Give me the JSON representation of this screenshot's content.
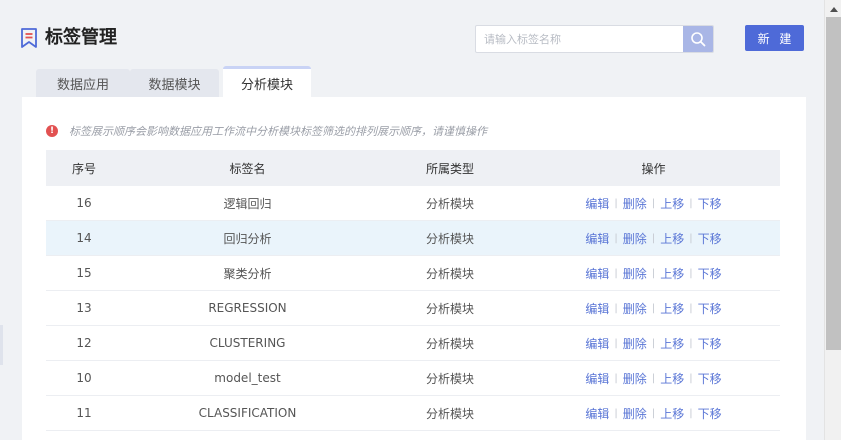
{
  "header": {
    "title": "标签管理",
    "search_placeholder": "请输入标签名称",
    "search_value": "",
    "new_button": "新 建",
    "icon": "bookmark-list-icon"
  },
  "tabs": [
    {
      "label": "数据应用",
      "active": false
    },
    {
      "label": "数据模块",
      "active": false
    },
    {
      "label": "分析模块",
      "active": true
    }
  ],
  "notice": {
    "icon": "alert-circle-icon",
    "text": "标签展示顺序会影响数据应用工作流中分析模块标签筛选的排列展示顺序，请谨慎操作"
  },
  "table": {
    "headers": [
      "序号",
      "标签名",
      "所属类型",
      "操作"
    ],
    "actions": [
      "编辑",
      "删除",
      "上移",
      "下移"
    ],
    "rows": [
      {
        "index": "16",
        "name": "逻辑回归",
        "type": "分析模块"
      },
      {
        "index": "14",
        "name": "回归分析",
        "type": "分析模块"
      },
      {
        "index": "15",
        "name": "聚类分析",
        "type": "分析模块"
      },
      {
        "index": "13",
        "name": "REGRESSION",
        "type": "分析模块"
      },
      {
        "index": "12",
        "name": "CLUSTERING",
        "type": "分析模块"
      },
      {
        "index": "10",
        "name": "model_test",
        "type": "分析模块"
      },
      {
        "index": "11",
        "name": "CLASSIFICATION",
        "type": "分析模块"
      }
    ],
    "highlighted_row": 1
  },
  "colors": {
    "accent": "#4e6ad8",
    "link": "#5a76d6",
    "alert": "#e25151",
    "row_highlight": "#eaf4fb"
  }
}
